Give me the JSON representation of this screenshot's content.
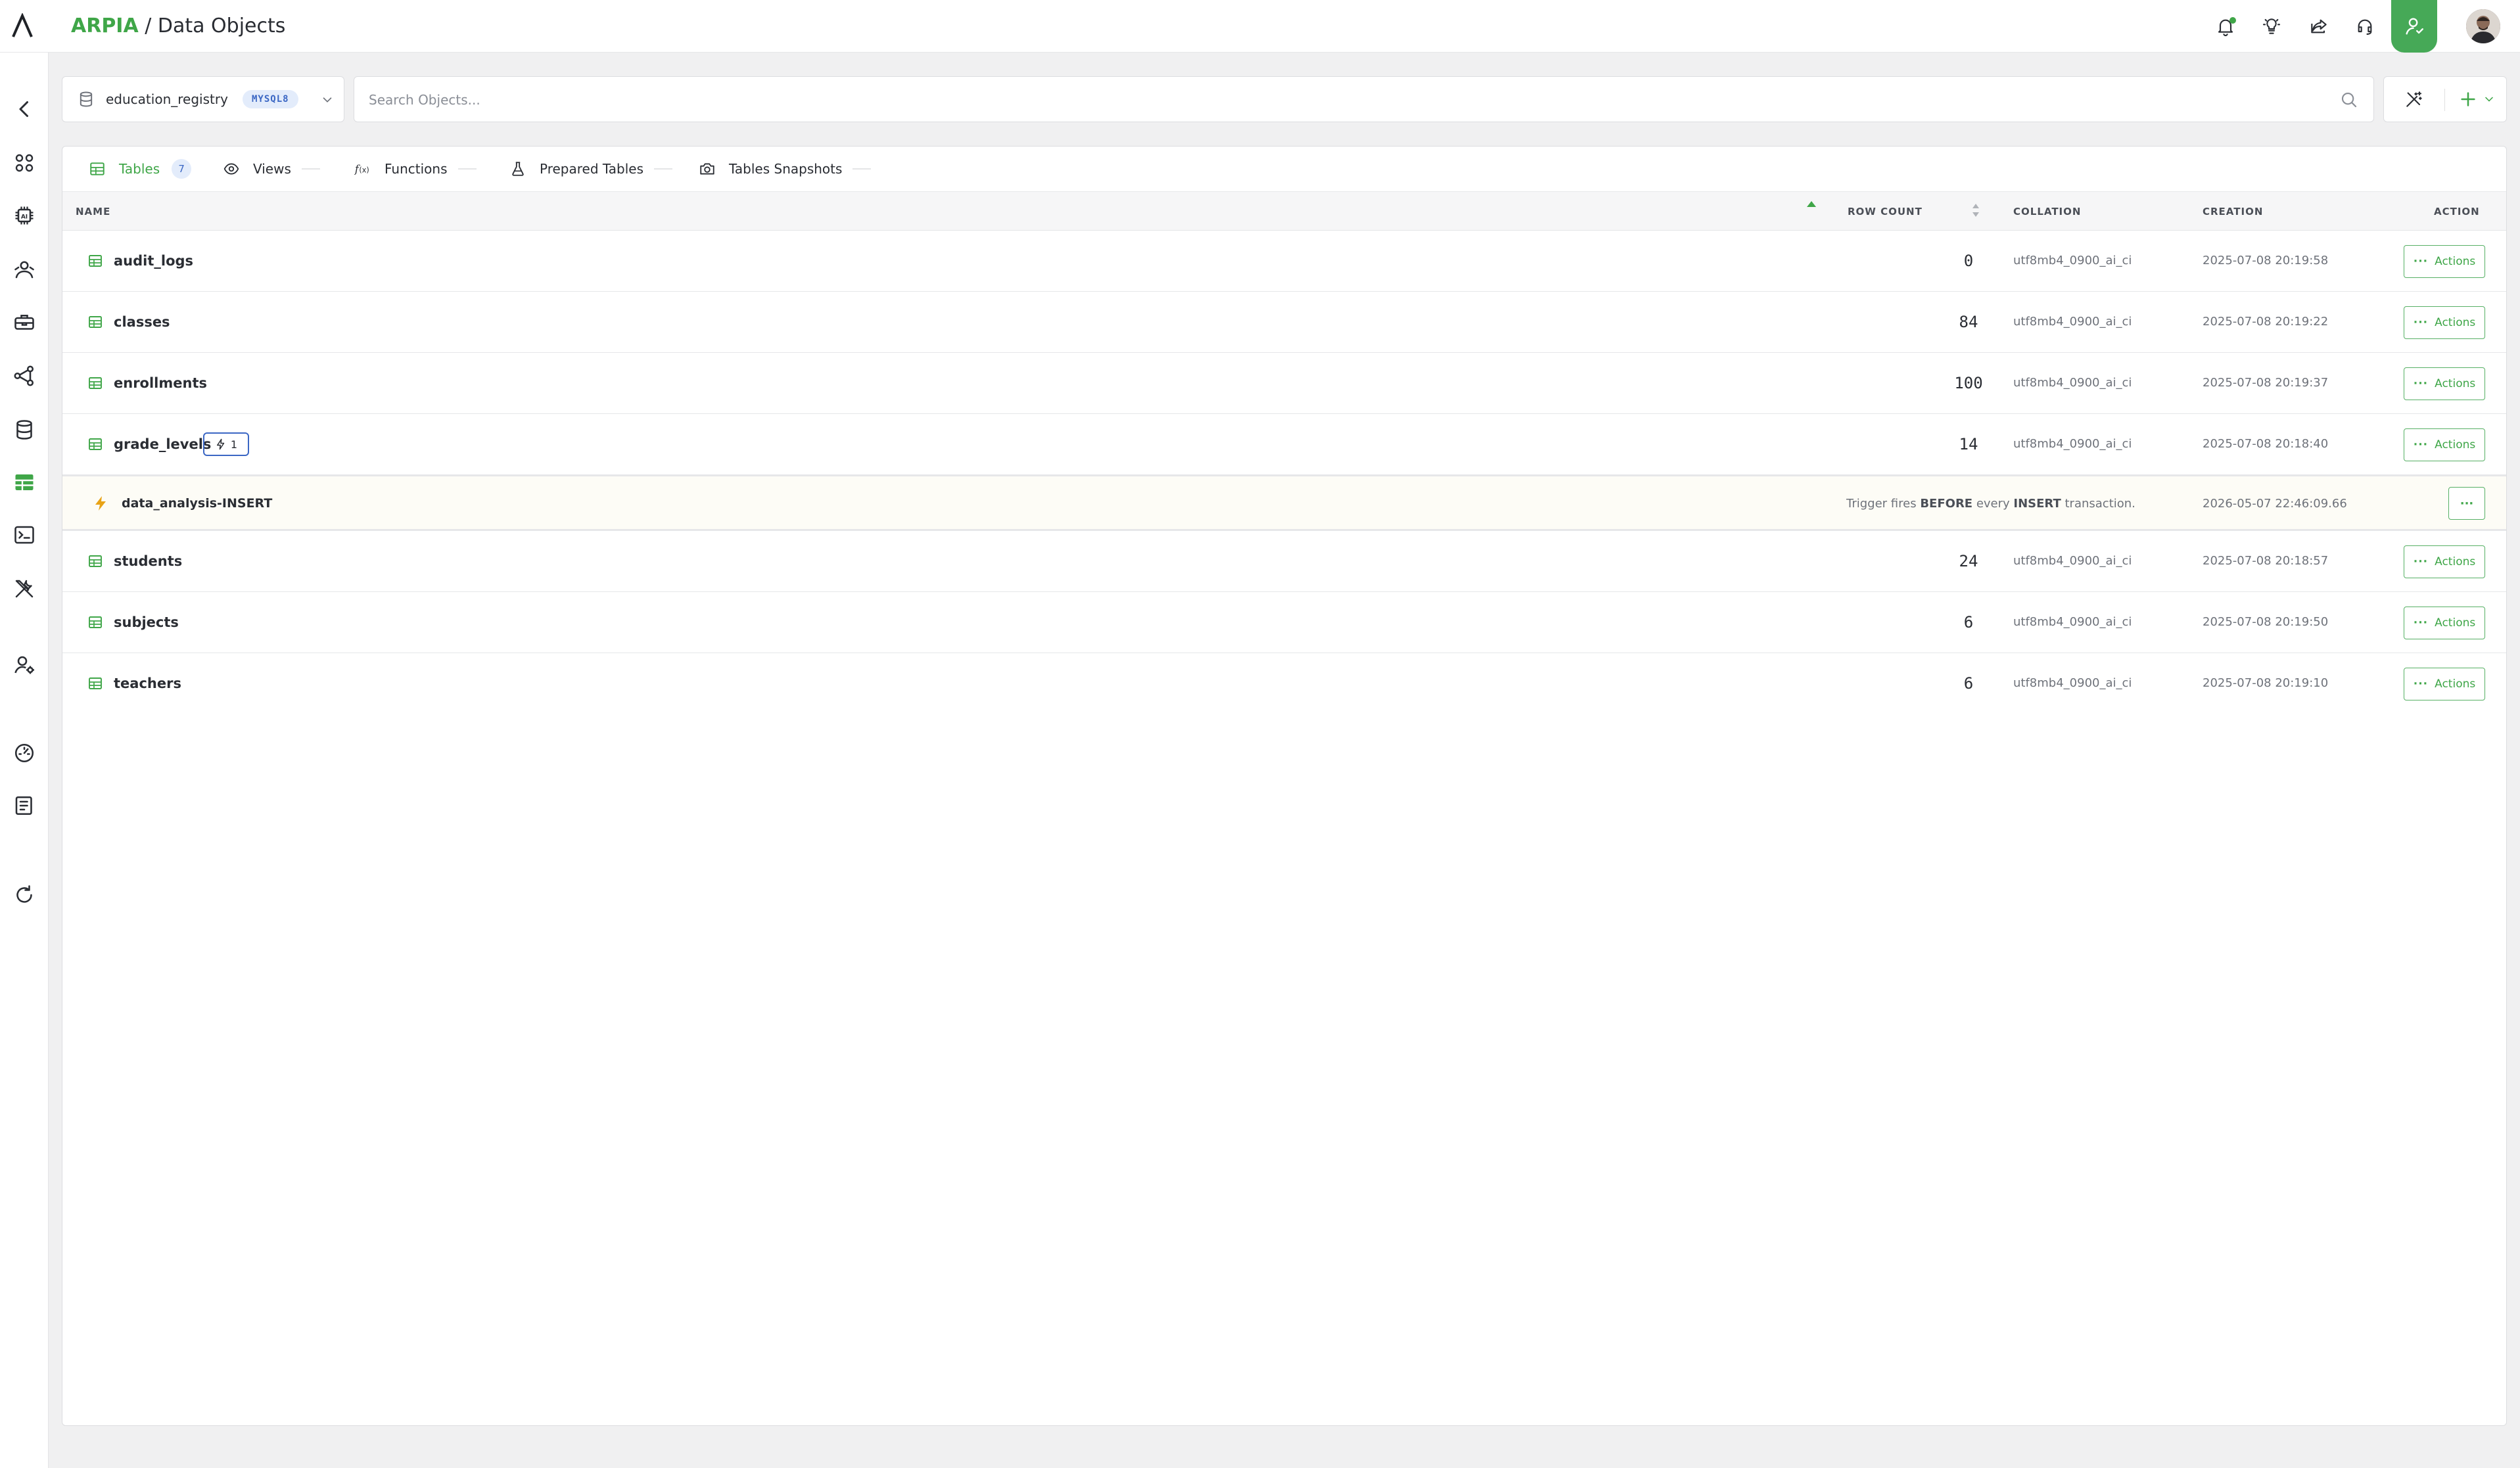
{
  "header": {
    "brand": "ARPIA",
    "separator": " / ",
    "page_title": "Data Objects"
  },
  "database_selector": {
    "name": "education_registry",
    "engine_badge": "MYSQL8"
  },
  "search": {
    "placeholder": "Search Objects..."
  },
  "tabs": [
    {
      "label": "Tables",
      "count": "7",
      "active": true,
      "icon": "table-icon"
    },
    {
      "label": "Views",
      "icon": "eye-icon"
    },
    {
      "label": "Functions",
      "icon": "function-icon"
    },
    {
      "label": "Prepared Tables",
      "icon": "flask-icon"
    },
    {
      "label": "Tables Snapshots",
      "icon": "camera-icon"
    }
  ],
  "table": {
    "columns": {
      "name": "NAME",
      "row_count": "ROW COUNT",
      "collation": "COLLATION",
      "creation": "CREATION",
      "action": "ACTION"
    },
    "rows": [
      {
        "name": "audit_logs",
        "row_count": "0",
        "collation": "utf8mb4_0900_ai_ci",
        "creation": "2025-07-08 20:19:58",
        "action": "Actions"
      },
      {
        "name": "classes",
        "row_count": "84",
        "collation": "utf8mb4_0900_ai_ci",
        "creation": "2025-07-08 20:19:22",
        "action": "Actions"
      },
      {
        "name": "enrollments",
        "row_count": "100",
        "collation": "utf8mb4_0900_ai_ci",
        "creation": "2025-07-08 20:19:37",
        "action": "Actions"
      },
      {
        "name": "grade_levels",
        "trigger_count": "1",
        "row_count": "14",
        "collation": "utf8mb4_0900_ai_ci",
        "creation": "2025-07-08 20:18:40",
        "action": "Actions"
      },
      {
        "name": "students",
        "row_count": "24",
        "collation": "utf8mb4_0900_ai_ci",
        "creation": "2025-07-08 20:18:57",
        "action": "Actions"
      },
      {
        "name": "subjects",
        "row_count": "6",
        "collation": "utf8mb4_0900_ai_ci",
        "creation": "2025-07-08 20:19:50",
        "action": "Actions"
      },
      {
        "name": "teachers",
        "row_count": "6",
        "collation": "utf8mb4_0900_ai_ci",
        "creation": "2025-07-08 20:19:10",
        "action": "Actions"
      }
    ],
    "trigger": {
      "name": "data_analysis-INSERT",
      "desc_prefix": "Trigger fires ",
      "timing": "BEFORE",
      "desc_mid": " every ",
      "event": "INSERT",
      "desc_suffix": " transaction.",
      "creation": "2026-05-07 22:46:09.66",
      "menu": "···"
    },
    "dots": "···"
  },
  "colors": {
    "accent": "#3fa648",
    "badge_blue": "#3b67c4",
    "trigger_bolt": "#e8a317"
  }
}
